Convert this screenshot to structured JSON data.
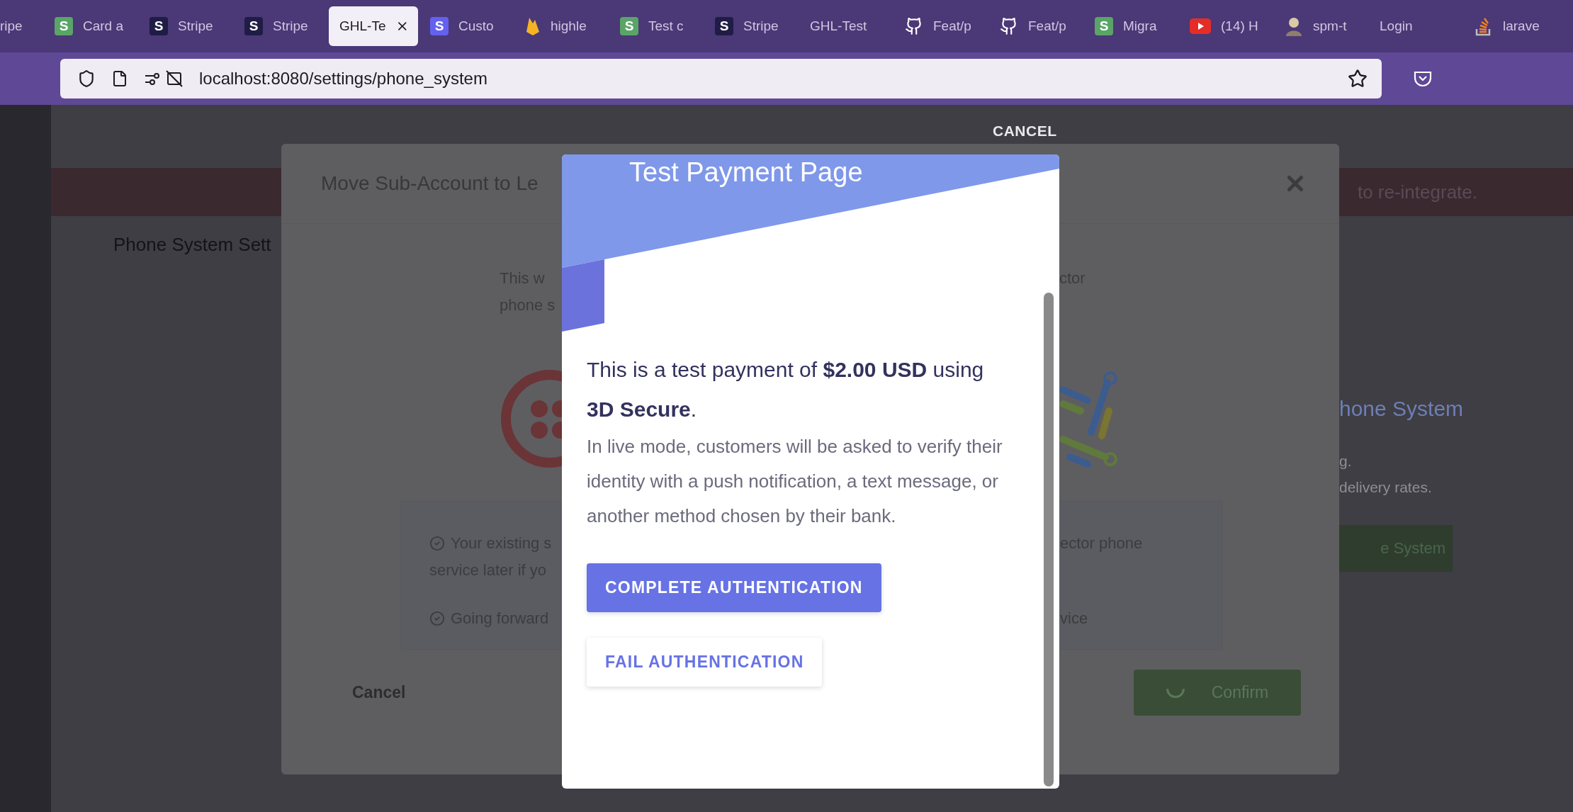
{
  "browser": {
    "tabs": [
      {
        "label": "ripe",
        "kind": "none",
        "selected": false
      },
      {
        "label": "Card a",
        "kind": "s-green",
        "letter": "S",
        "selected": false
      },
      {
        "label": "Stripe",
        "kind": "s-dark",
        "letter": "S",
        "selected": false
      },
      {
        "label": "Stripe",
        "kind": "s-dark",
        "letter": "S",
        "selected": false
      },
      {
        "label": "GHL-Te",
        "kind": "none",
        "selected": true
      },
      {
        "label": "Custo",
        "kind": "s-purple",
        "letter": "S",
        "selected": false
      },
      {
        "label": "highle",
        "kind": "flame",
        "selected": false
      },
      {
        "label": "Test c",
        "kind": "s-green",
        "letter": "S",
        "selected": false
      },
      {
        "label": "Stripe",
        "kind": "s-dark",
        "letter": "S",
        "selected": false
      },
      {
        "label": "GHL-Test",
        "kind": "none",
        "selected": false
      },
      {
        "label": "Feat/p",
        "kind": "github",
        "selected": false
      },
      {
        "label": "Feat/p",
        "kind": "github",
        "selected": false
      },
      {
        "label": "Migra",
        "kind": "s-green",
        "letter": "S",
        "selected": false
      },
      {
        "label": "(14) H",
        "kind": "youtube",
        "selected": false
      },
      {
        "label": "spm-t",
        "kind": "avatar",
        "selected": false
      },
      {
        "label": "Login",
        "kind": "none",
        "selected": false
      },
      {
        "label": "larave",
        "kind": "stack",
        "selected": false
      }
    ],
    "address": "localhost:8080/settings/phone_system"
  },
  "page": {
    "banner": "to re-integrate.",
    "heading": "Phone System Sett",
    "right_title": "hone System",
    "right_lines": [
      "g.",
      "delivery rates."
    ],
    "right_button": "e System"
  },
  "move_dialog": {
    "title": "Move Sub-Account to Le",
    "intro_left": [
      "This w",
      "phone s"
    ],
    "intro_right": [
      "ctor"
    ],
    "notes_left": [
      [
        "Your existing s",
        "service later if yo"
      ],
      [
        "Going forward"
      ]
    ],
    "notes_right": [
      [
        "ector phone"
      ],
      [
        "vice"
      ]
    ],
    "cancel": "Cancel",
    "confirm": "Confirm",
    "confirm_loading": true
  },
  "cancel_link": "CANCEL",
  "payment_dialog": {
    "title": "Test Payment Page",
    "summary": "This is a test payment of **$2.00 USD** using **3D Secure**.",
    "description": "In live mode, customers will be asked to verify their identity with a push notification, a text message, or another method chosen by their bank.",
    "buttons": [
      {
        "label": "COMPLETE AUTHENTICATION",
        "kind": "primary"
      },
      {
        "label": "FAIL AUTHENTICATION",
        "kind": "secondary"
      }
    ]
  }
}
